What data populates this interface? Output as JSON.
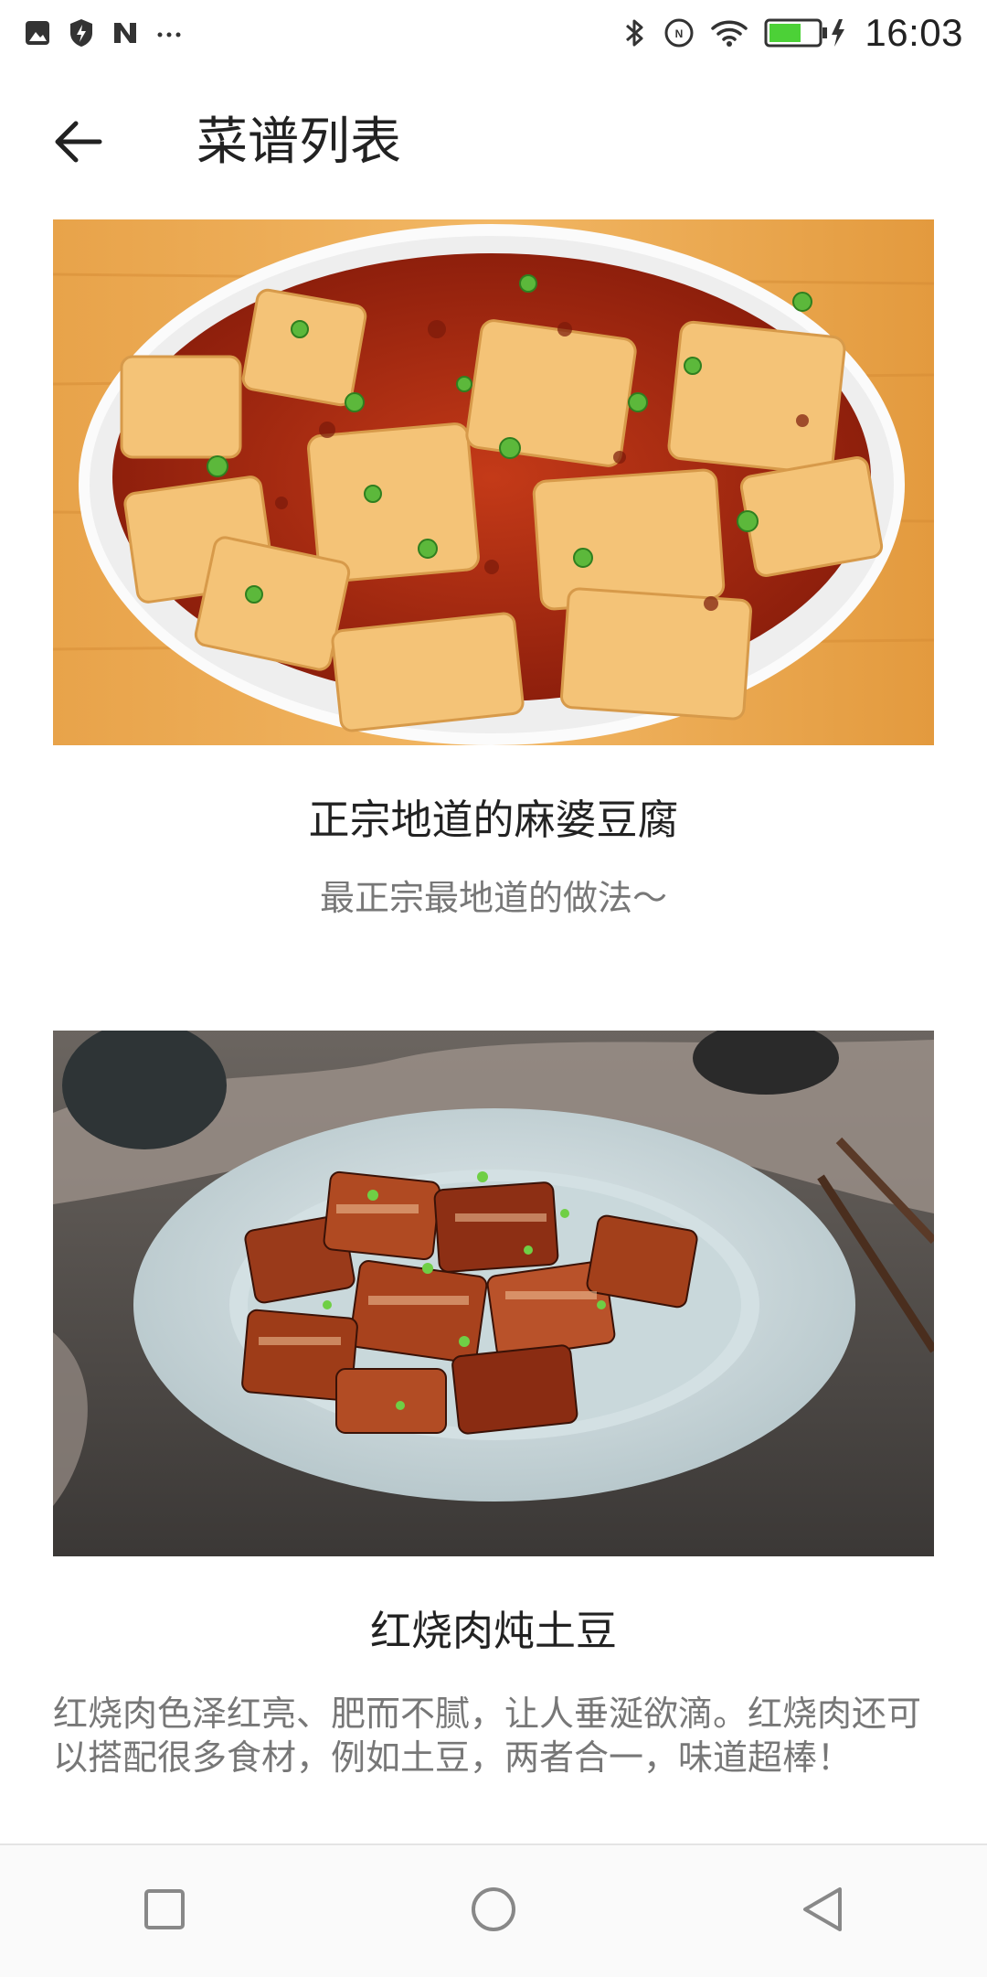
{
  "status_bar": {
    "time": "16:03",
    "left_icons": [
      "gallery-icon",
      "shield-bolt-icon",
      "n-logo-icon",
      "more-dots-icon"
    ],
    "right_icons": [
      "bluetooth-icon",
      "nfc-icon",
      "wifi-icon",
      "battery-charging-icon"
    ],
    "battery_color": "#4cd137"
  },
  "app_bar": {
    "title": "菜谱列表",
    "back_icon": "arrow-left-icon"
  },
  "recipes": [
    {
      "title": "正宗地道的麻婆豆腐",
      "description": "最正宗最地道的做法～",
      "image": "mapo-tofu-photo"
    },
    {
      "title": "红烧肉炖土豆",
      "description": "红烧肉色泽红亮、肥而不腻，让人垂涎欲滴。红烧肉还可以搭配很多食材，例如土豆，两者合一，味道超棒！",
      "image": "braised-pork-photo"
    }
  ],
  "nav_bar": {
    "buttons": [
      "recents-square-icon",
      "home-circle-icon",
      "back-triangle-icon"
    ]
  },
  "colors": {
    "background": "#ffffff",
    "title_text": "#222222",
    "description_text": "#777777"
  }
}
